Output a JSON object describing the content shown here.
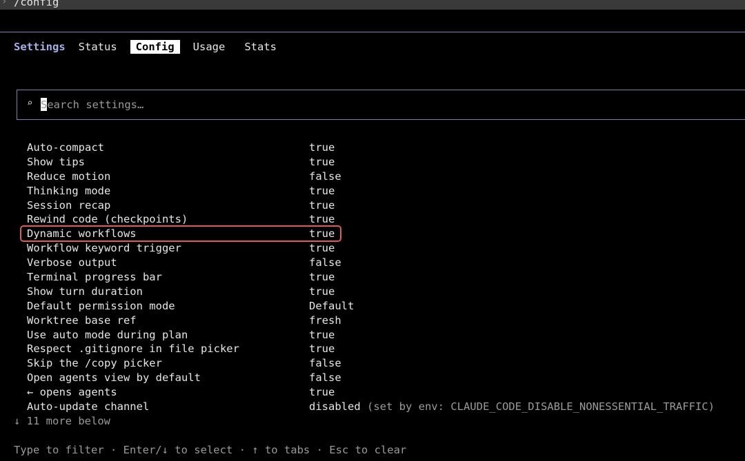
{
  "command": {
    "prompt_glyph": "›",
    "text": "/config"
  },
  "tabs": {
    "section_label": "Settings",
    "items": [
      {
        "label": "Status"
      },
      {
        "label": "Config"
      },
      {
        "label": "Usage"
      },
      {
        "label": "Stats"
      }
    ],
    "active": "Config"
  },
  "search": {
    "icon": "⌕",
    "placeholder": "Search settings…",
    "value": ""
  },
  "settings": [
    {
      "label": "Auto-compact",
      "value": "true"
    },
    {
      "label": "Show tips",
      "value": "true"
    },
    {
      "label": "Reduce motion",
      "value": "false"
    },
    {
      "label": "Thinking mode",
      "value": "true"
    },
    {
      "label": "Session recap",
      "value": "true"
    },
    {
      "label": "Rewind code (checkpoints)",
      "value": "true"
    },
    {
      "label": "Dynamic workflows",
      "value": "true"
    },
    {
      "label": "Workflow keyword trigger",
      "value": "true"
    },
    {
      "label": "Verbose output",
      "value": "false"
    },
    {
      "label": "Terminal progress bar",
      "value": "true"
    },
    {
      "label": "Show turn duration",
      "value": "true"
    },
    {
      "label": "Default permission mode",
      "value": "Default"
    },
    {
      "label": "Worktree base ref",
      "value": "fresh"
    },
    {
      "label": "Use auto mode during plan",
      "value": "true"
    },
    {
      "label": "Respect .gitignore in file picker",
      "value": "true"
    },
    {
      "label": "Skip the /copy picker",
      "value": "false"
    },
    {
      "label": "Open agents view by default",
      "value": "false"
    },
    {
      "label": "← opens agents",
      "value": "true"
    },
    {
      "label": "Auto-update channel",
      "value": "disabled",
      "note": " (set by env: CLAUDE_CODE_DISABLE_NONESSENTIAL_TRAFFIC)"
    }
  ],
  "highlighted_setting": "Dynamic workflows",
  "highlight_color": "#e05a5a",
  "more_below": "↓ 11 more below",
  "hint": "Type to filter · Enter/↓ to select · ↑ to tabs · Esc to clear",
  "colors": {
    "accent": "#a6aee8",
    "border": "#7f84b8",
    "muted": "#9a9a9a",
    "background": "#000000"
  }
}
